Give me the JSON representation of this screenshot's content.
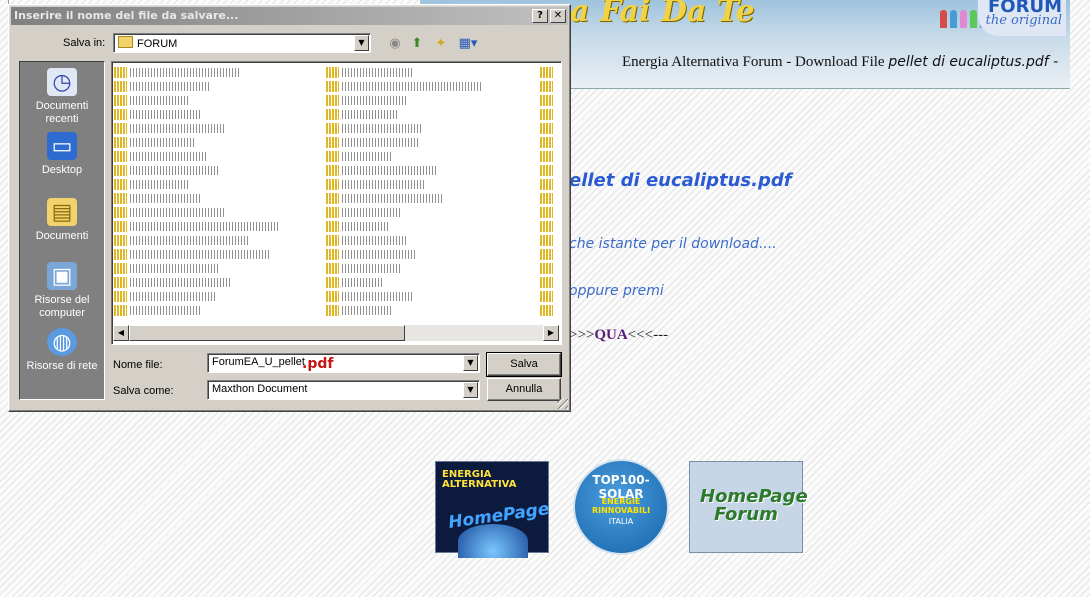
{
  "page": {
    "banner_brand": "a Fai Da Te",
    "forum_logo_main": "FORUM",
    "forum_logo_sub": "the original",
    "caption_prefix": "Energia Alternativa Forum - Download File",
    "caption_file": "pellet di eucaliptus.pdf -",
    "file_title": "ellet di eucaliptus.pdf",
    "wait_text": "che istante per il download....",
    "or_text": "oppure premi",
    "link_prefix": ">>>",
    "link_word": "QUA",
    "link_suffix": "<<<---",
    "badges": {
      "energia_title": "ENERGIA ALTERNATIVA",
      "energia_sub": "HomePage",
      "top100_title": "TOP100-SOLAR",
      "top100_sub": "ENERGIE RINNOVABILI",
      "top100_country": "ITALIA",
      "homepage_text": "HomePage Forum"
    }
  },
  "dialog": {
    "title": "Inserire il nome del file da salvare...",
    "help_label": "?",
    "close_label": "✕",
    "save_in_label": "Salva in:",
    "save_in_value": "FORUM",
    "toolbar_icons": [
      "back-icon",
      "up-folder-icon",
      "new-folder-icon",
      "view-menu-icon"
    ],
    "places": [
      {
        "label": "Documenti recenti",
        "icon": "recent-documents-icon"
      },
      {
        "label": "Desktop",
        "icon": "desktop-icon"
      },
      {
        "label": "Documenti",
        "icon": "documents-folder-icon"
      },
      {
        "label": "Risorse del computer",
        "icon": "my-computer-icon"
      },
      {
        "label": "Risorse di rete",
        "icon": "network-icon"
      }
    ],
    "filename_label": "Nome file:",
    "filename_value": "ForumEA_U_pellet",
    "filename_ext_hint": ".pdf",
    "filetype_label": "Salva come:",
    "filetype_value": "Maxthon Document",
    "save_button": "Salva",
    "cancel_button": "Annulla"
  }
}
